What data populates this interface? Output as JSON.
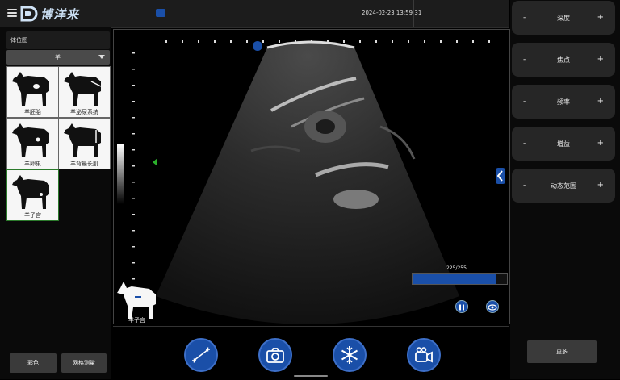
{
  "topbar": {
    "logo_text": "博洋来",
    "datetime": "2024-02-23 13:59:31"
  },
  "left_panel": {
    "header": "体位图",
    "animal_selected": "羊",
    "thumbnails": [
      {
        "label": "羊胚胎"
      },
      {
        "label": "羊泌尿系统"
      },
      {
        "label": "羊卵巢"
      },
      {
        "label": "羊背最长肌"
      },
      {
        "label": "羊子宫"
      }
    ],
    "color_button": "彩色",
    "grid_button": "网格测量"
  },
  "viewport": {
    "gain_readout": "225/255",
    "gain_level": 0.88,
    "body_mark_label": "羊子宫"
  },
  "controls": [
    {
      "label": "深度",
      "minus": "-",
      "plus": "+"
    },
    {
      "label": "焦点",
      "minus": "-",
      "plus": "+"
    },
    {
      "label": "频率",
      "minus": "-",
      "plus": "+"
    },
    {
      "label": "增益",
      "minus": "-",
      "plus": "+"
    },
    {
      "label": "动态范围",
      "minus": "-",
      "plus": "+"
    }
  ],
  "more_button": "更多",
  "colors": {
    "accent": "#1a4fa8",
    "marker_green": "#2bb02b",
    "panel": "#262626"
  },
  "icons": [
    "menu-icon",
    "measure-icon",
    "camera-icon",
    "freeze-icon",
    "video-icon",
    "pause-icon",
    "eye-icon",
    "chevron-left-icon"
  ]
}
